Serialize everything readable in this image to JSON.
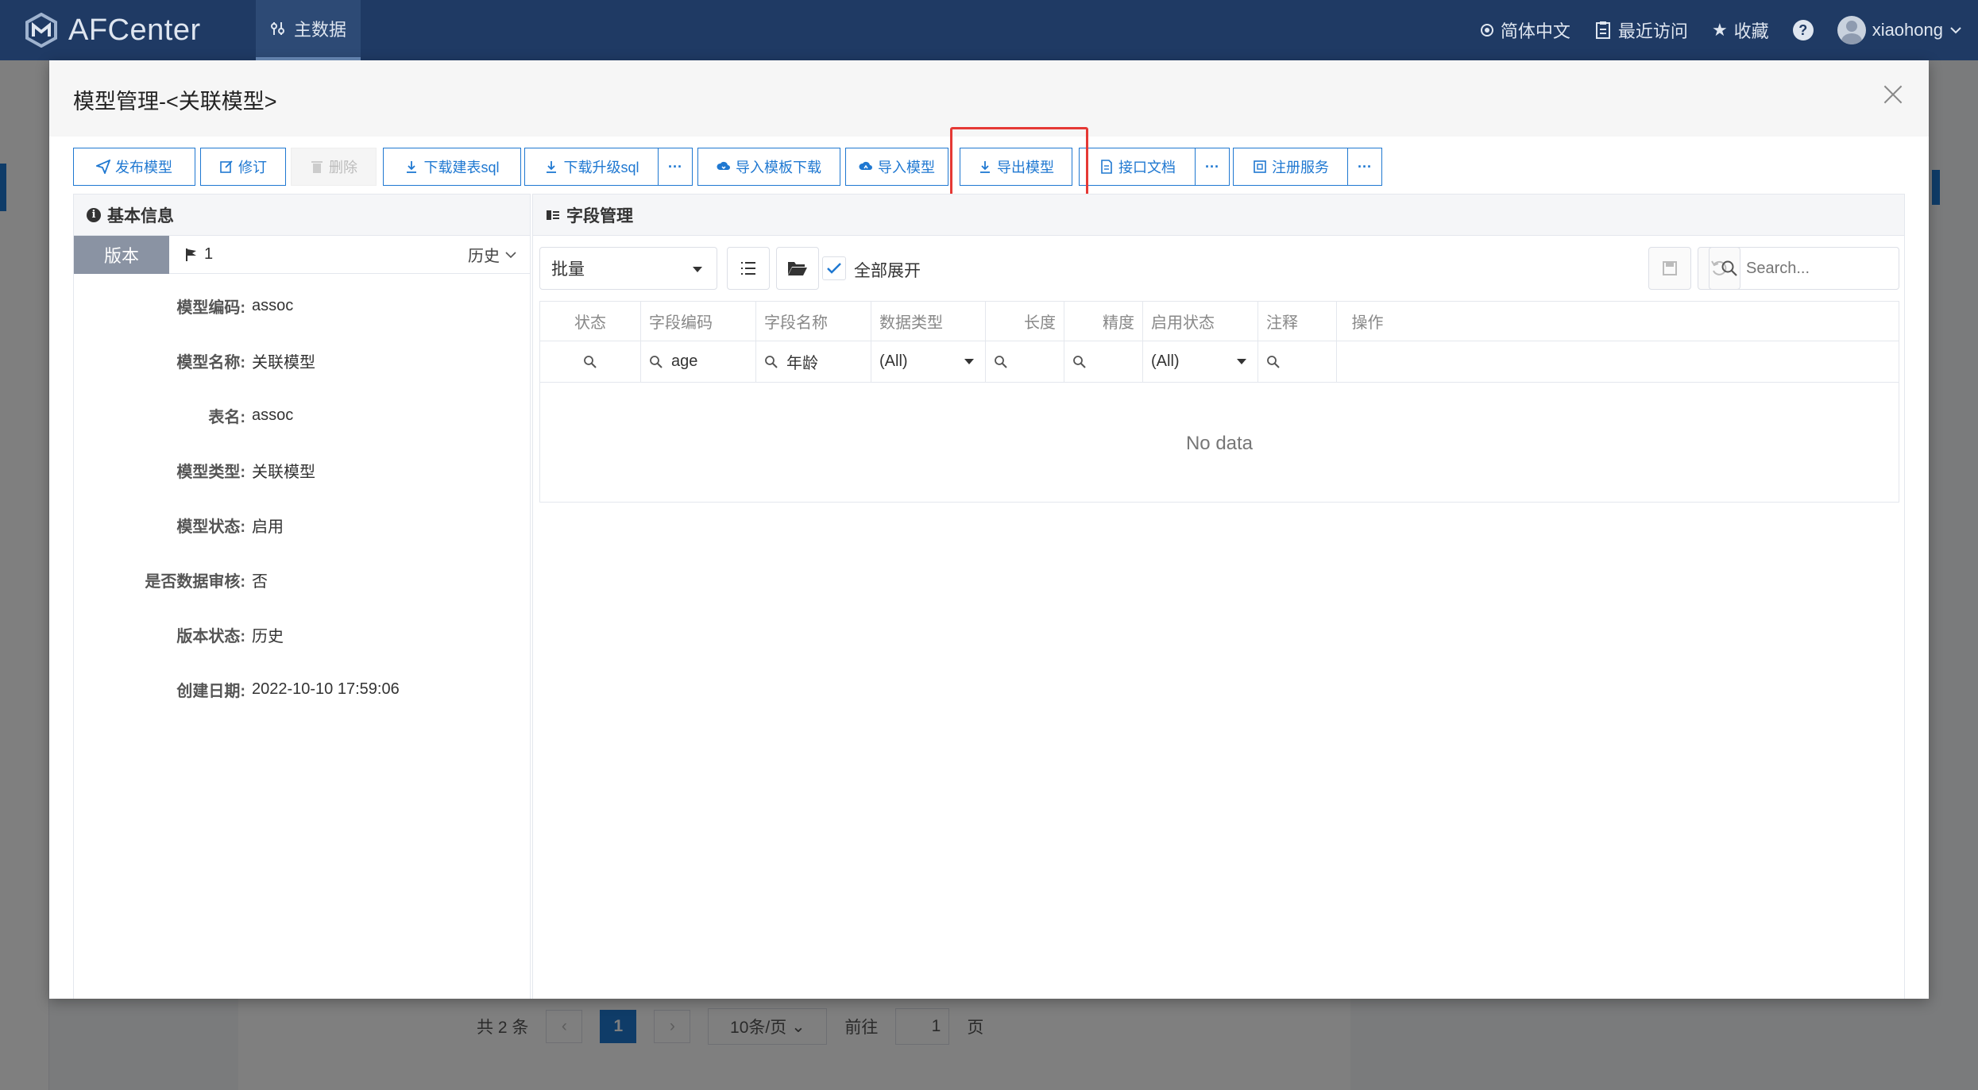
{
  "app": {
    "name": "AFCenter",
    "nav_tab": "主数据"
  },
  "topbar": {
    "language": "简体中文",
    "recent": "最近访问",
    "favorites": "收藏",
    "help": "?",
    "user": "xiaohong"
  },
  "background": {
    "pager": {
      "total": "共 2 条",
      "current": "1",
      "page_size": "10条/页",
      "goto_label": "前往",
      "goto_value": "1",
      "page_unit": "页"
    }
  },
  "modal": {
    "title": "模型管理-<关联模型>",
    "toolbar": {
      "publish": "发布模型",
      "revise": "修订",
      "delete": "删除",
      "download_create_sql": "下载建表sql",
      "download_upgrade_sql": "下载升级sql",
      "more": "···",
      "import_template_download": "导入模板下载",
      "import_model": "导入模型",
      "export_model": "导出模型",
      "api_doc": "接口文档",
      "register_service": "注册服务"
    },
    "basic_info": {
      "header": "基本信息",
      "version_tab": "版本",
      "version_number": "1",
      "history": "历史",
      "fields": [
        {
          "label": "模型编码:",
          "value": "assoc"
        },
        {
          "label": "模型名称:",
          "value": "关联模型"
        },
        {
          "label": "表名:",
          "value": "assoc"
        },
        {
          "label": "模型类型:",
          "value": "关联模型"
        },
        {
          "label": "模型状态:",
          "value": "启用"
        },
        {
          "label": "是否数据审核:",
          "value": "否"
        },
        {
          "label": "版本状态:",
          "value": "历史"
        },
        {
          "label": "创建日期:",
          "value": "2022-10-10 17:59:06"
        }
      ]
    },
    "field_mgmt": {
      "header": "字段管理",
      "batch_select": "批量",
      "expand_all": "全部展开",
      "search_placeholder": "Search...",
      "columns": [
        "状态",
        "字段编码",
        "字段名称",
        "数据类型",
        "长度",
        "精度",
        "启用状态",
        "注释",
        "操作"
      ],
      "filters": {
        "code": "age",
        "name": "年龄",
        "data_type": "(All)",
        "enable_status": "(All)"
      },
      "empty_text": "No data"
    }
  }
}
